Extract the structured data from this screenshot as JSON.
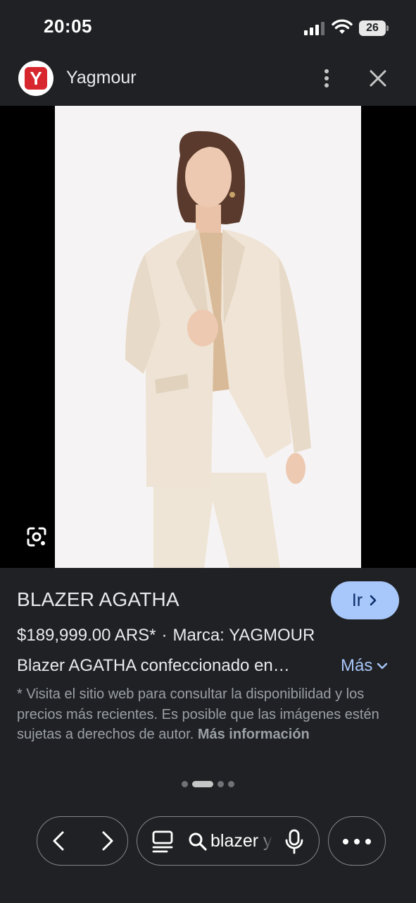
{
  "status_bar": {
    "time": "20:05",
    "battery": "26"
  },
  "header": {
    "logo_letter": "Y",
    "site_name": "Yagmour"
  },
  "product": {
    "title": "BLAZER AGATHA",
    "go_label": "Ir",
    "price": "$189,999.00 ARS*",
    "separator": "·",
    "brand": "Marca: YAGMOUR",
    "description": "Blazer AGATHA confeccionado en…",
    "more_label": "Más",
    "disclaimer": "* Visita el sitio web para consultar la disponibilidad y los precios más recientes. Es posible que las imágenes estén sujetas a derechos de autor.",
    "more_info_label": "Más información"
  },
  "pager": {
    "count": 4,
    "active_index": 1
  },
  "toolbar": {
    "search_query": "blazer yagmour"
  },
  "colors": {
    "background": "#202124",
    "accent_button": "#a8c7fa",
    "link": "#a8c7fa",
    "logo_red": "#d7262e"
  }
}
